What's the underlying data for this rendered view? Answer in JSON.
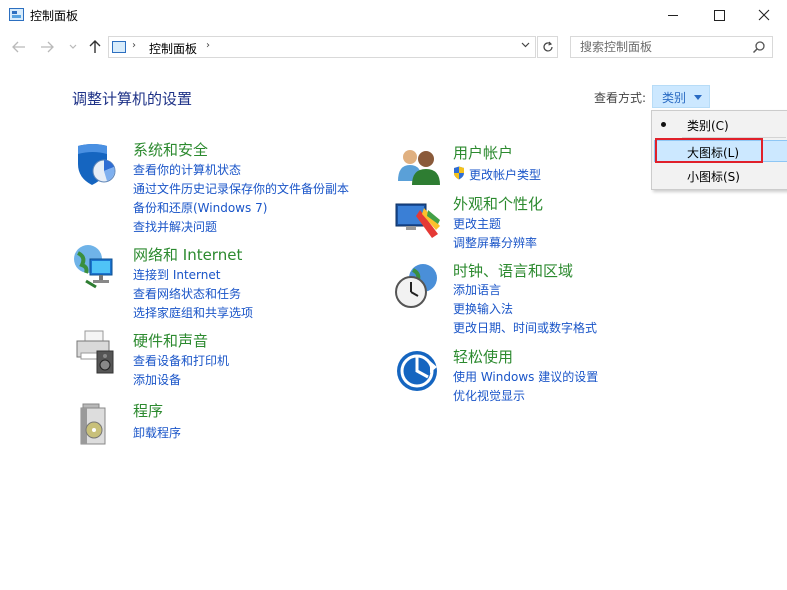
{
  "window": {
    "title": "控制面板"
  },
  "nav": {
    "address_path": "控制面板",
    "search_placeholder": "搜索控制面板"
  },
  "header": {
    "heading": "调整计算机的设置",
    "view_by_label": "查看方式:",
    "view_by_value": "类别"
  },
  "view_menu": {
    "items": [
      {
        "label": "类别(C)",
        "selected": true
      },
      {
        "label": "大图标(L)",
        "hovered": true
      },
      {
        "label": "小图标(S)"
      }
    ]
  },
  "categories_left": [
    {
      "title": "系统和安全",
      "icon": "shield-icon",
      "links": [
        "查看你的计算机状态",
        "通过文件历史记录保存你的文件备份副本",
        "备份和还原(Windows 7)",
        "查找并解决问题"
      ]
    },
    {
      "title": "网络和 Internet",
      "icon": "network-globe-icon",
      "links": [
        "连接到 Internet",
        "查看网络状态和任务",
        "选择家庭组和共享选项"
      ]
    },
    {
      "title": "硬件和声音",
      "icon": "printer-speaker-icon",
      "links": [
        "查看设备和打印机",
        "添加设备"
      ]
    },
    {
      "title": "程序",
      "icon": "programs-disc-icon",
      "links": [
        "卸载程序"
      ]
    }
  ],
  "categories_right": [
    {
      "title": "用户帐户",
      "icon": "users-icon",
      "links": [
        "更改帐户类型"
      ]
    },
    {
      "title": "外观和个性化",
      "icon": "monitor-palette-icon",
      "links": [
        "更改主题",
        "调整屏幕分辨率"
      ]
    },
    {
      "title": "时钟、语言和区域",
      "icon": "clock-globe-icon",
      "links": [
        "添加语言",
        "更换输入法",
        "更改日期、时间或数字格式"
      ]
    },
    {
      "title": "轻松使用",
      "icon": "ease-of-access-icon",
      "links": [
        "使用 Windows 建议的设置",
        "优化视觉显示"
      ]
    }
  ],
  "colors": {
    "category_title": "#2c8a2f",
    "link": "#1a55c8",
    "heading": "#1e3287",
    "menu_highlight": "#cce8ff",
    "annotation_box": "#e0202a"
  }
}
